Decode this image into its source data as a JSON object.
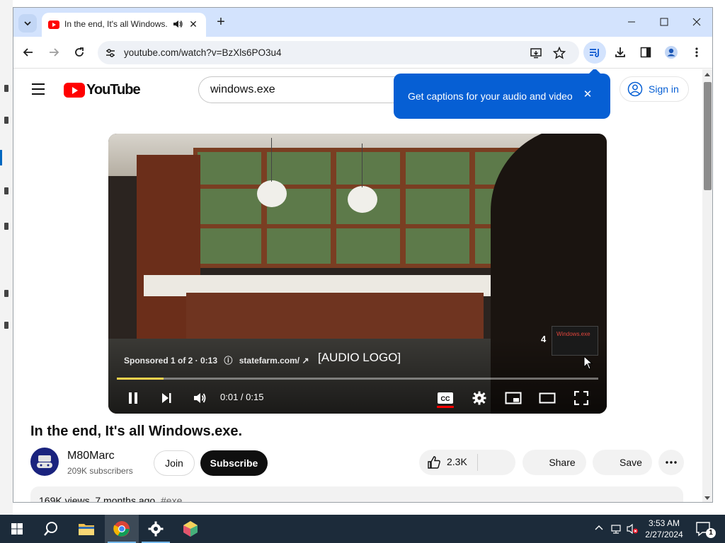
{
  "browser": {
    "tab_title": "In the end, It's all Windows.exe - YouTube",
    "url": "youtube.com/watch?v=BzXls6PO3u4"
  },
  "youtube": {
    "logo_text": "YouTube",
    "search_value": "windows.exe",
    "tooltip_text": "Get captions for your audio and video",
    "tooltip_close": "✕",
    "signin_label": "Sign in"
  },
  "player": {
    "ad_sponsored": "Sponsored 1 of 2 · 0:13",
    "ad_domain": "statefarm.com/",
    "audio_logo": "[AUDIO LOGO]",
    "skip_count": "4",
    "skip_thumb_text": "Windows.exe",
    "time": "0:01 / 0:15",
    "progress_fraction": 0.097
  },
  "video": {
    "title": "In the end, It's all Windows.exe.",
    "channel_name": "M80Marc",
    "subscribers": "209K subscribers",
    "join_label": "Join",
    "subscribe_label": "Subscribe",
    "like_count": "2.3K",
    "share_label": "Share",
    "save_label": "Save",
    "views": "169K views",
    "age": "7 months ago",
    "hashtag": "#exe"
  },
  "taskbar": {
    "time": "3:53 AM",
    "date": "2/27/2024",
    "notification_count": "1"
  },
  "colors": {
    "youtube_red": "#ff0000",
    "tooltip_blue": "#065fd4",
    "progress_yellow": "#fcd34d",
    "taskbar_bg": "#1c2b3a"
  },
  "icons": [
    "tab-search-icon",
    "youtube-favicon",
    "audio-playing-icon",
    "close-icon",
    "new-tab-icon",
    "minimize-icon",
    "maximize-icon",
    "back-icon",
    "forward-icon",
    "reload-icon",
    "site-info-icon",
    "install-app-icon",
    "bookmark-star-icon",
    "media-control-icon",
    "download-icon",
    "side-panel-icon",
    "profile-icon",
    "menu-dots-icon",
    "hamburger-icon",
    "play-pause-icon",
    "next-icon",
    "volume-icon",
    "cc-icon",
    "settings-icon",
    "miniplayer-icon",
    "theater-icon",
    "fullscreen-icon",
    "like-icon",
    "windows-start-icon",
    "search-icon",
    "file-explorer-icon",
    "chrome-icon",
    "settings-app-icon",
    "app-icon"
  ]
}
